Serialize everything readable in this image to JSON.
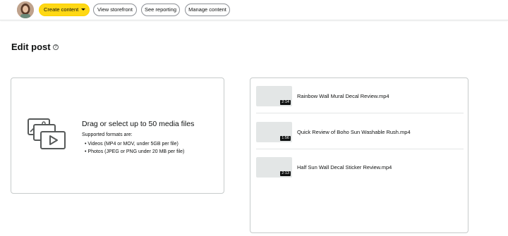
{
  "toolbar": {
    "create_label": "Create content",
    "storefront_label": "View storefront",
    "reporting_label": "See reporting",
    "manage_label": "Manage content"
  },
  "page": {
    "title": "Edit post",
    "help_glyph": "?"
  },
  "upload": {
    "heading": "Drag or select up to 50 media files",
    "formats_label": "Supported formats are:",
    "formats": [
      "Videos (MP4 or MOV, under 5GB per file)",
      "Photos (JPEG or PNG under 20 MB per file)"
    ]
  },
  "media": [
    {
      "name": "Rainbow Wall Mural Decal Review.mp4",
      "duration": "2:14"
    },
    {
      "name": "Quick Review of Boho Sun Washable Rush.mp4",
      "duration": "1:56"
    },
    {
      "name": "Half Sun Wall Decal Sticker Review.mp4",
      "duration": "2:13"
    }
  ],
  "colors": {
    "primary_button": "#ffd814",
    "border": "#c7cbcb",
    "thumbnail": "#e3e6e6"
  },
  "icons": {
    "create_dropdown": "chevron-down-icon",
    "help": "help-icon",
    "media": "media-upload-icon"
  }
}
